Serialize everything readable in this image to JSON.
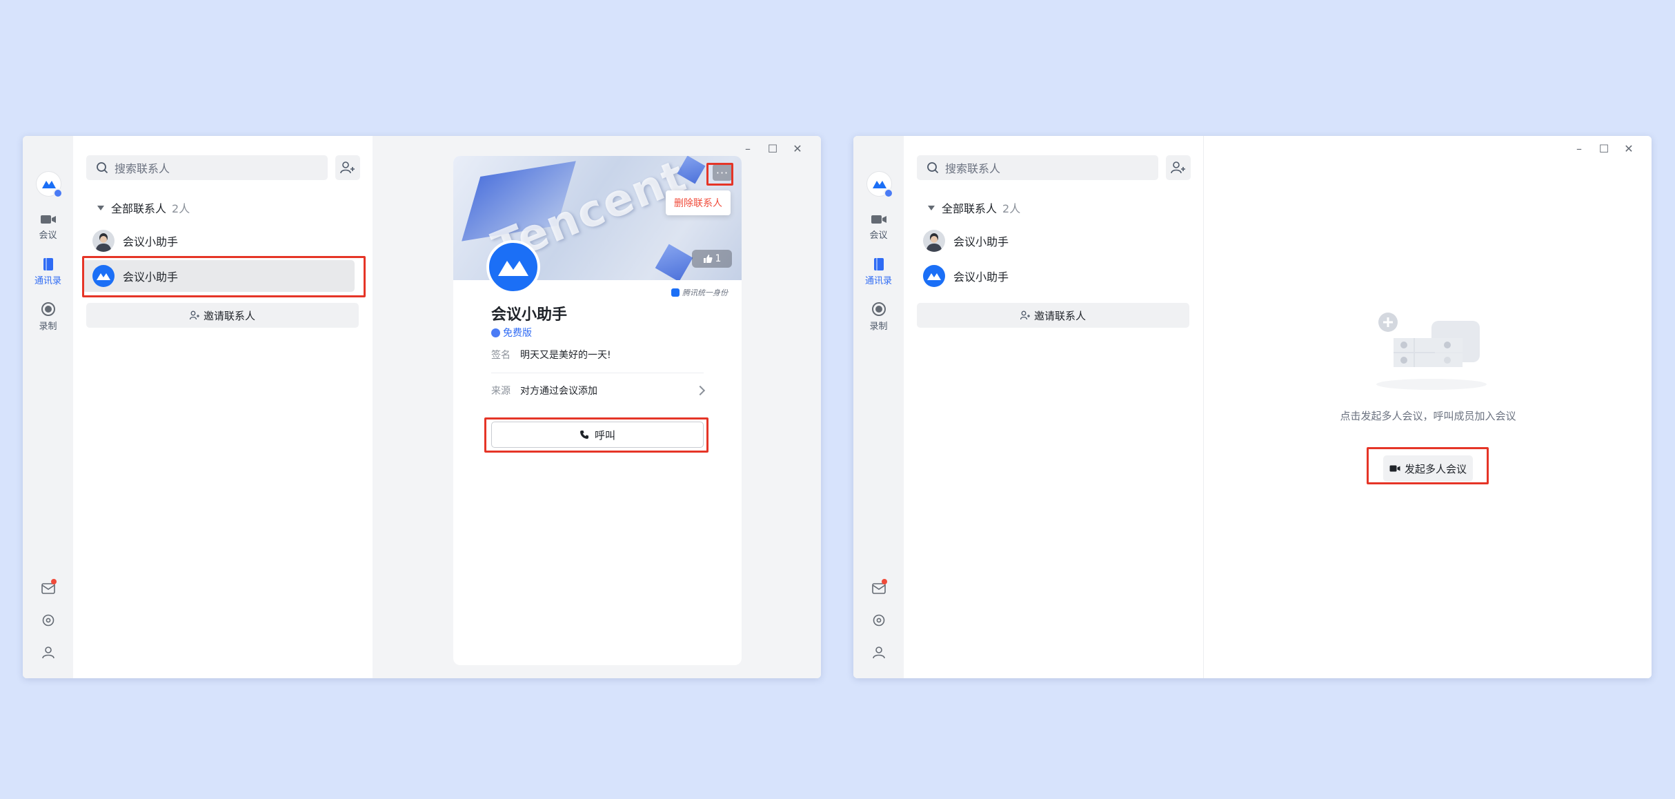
{
  "left_window": {
    "nav": {
      "meeting_label": "会议",
      "contacts_label": "通讯录",
      "recording_label": "录制"
    },
    "search": {
      "placeholder": "搜索联系人"
    },
    "group": {
      "label": "全部联系人",
      "count": "2人"
    },
    "contacts": [
      {
        "name": "会议小助手",
        "avatar": "person"
      },
      {
        "name": "会议小助手",
        "avatar": "brand-logo",
        "selected": true
      }
    ],
    "invite_label": "邀请联系人",
    "window_controls": [
      "minimize-icon",
      "maximize-icon",
      "close-icon"
    ],
    "profile_card": {
      "banner_watermark": "Tencent",
      "likes_count": "1",
      "more_label": "···",
      "delete_menu_item": "删除联系人",
      "identity_tag": "腾讯统一身份",
      "name": "会议小助手",
      "edition": "免费版",
      "signature_key": "签名",
      "signature_value": "明天又是美好的一天!",
      "source_key": "来源",
      "source_value": "对方通过会议添加",
      "call_label": "呼叫"
    }
  },
  "right_window": {
    "nav": {
      "meeting_label": "会议",
      "contacts_label": "通讯录",
      "recording_label": "录制"
    },
    "search": {
      "placeholder": "搜索联系人"
    },
    "group": {
      "label": "全部联系人",
      "count": "2人"
    },
    "contacts": [
      {
        "name": "会议小助手",
        "avatar": "person"
      },
      {
        "name": "会议小助手",
        "avatar": "brand-logo"
      }
    ],
    "invite_label": "邀请联系人",
    "window_controls": [
      "minimize-icon",
      "maximize-icon",
      "close-icon"
    ],
    "empty_state": {
      "hint": "点击发起多人会议，呼叫成员加入会议",
      "start_button": "发起多人会议"
    }
  },
  "colors": {
    "background": "#d7e3fc",
    "accent": "#2f6bf4",
    "highlight": "#e53527",
    "danger": "#f04b3a",
    "brand": "#1b6ff6"
  }
}
